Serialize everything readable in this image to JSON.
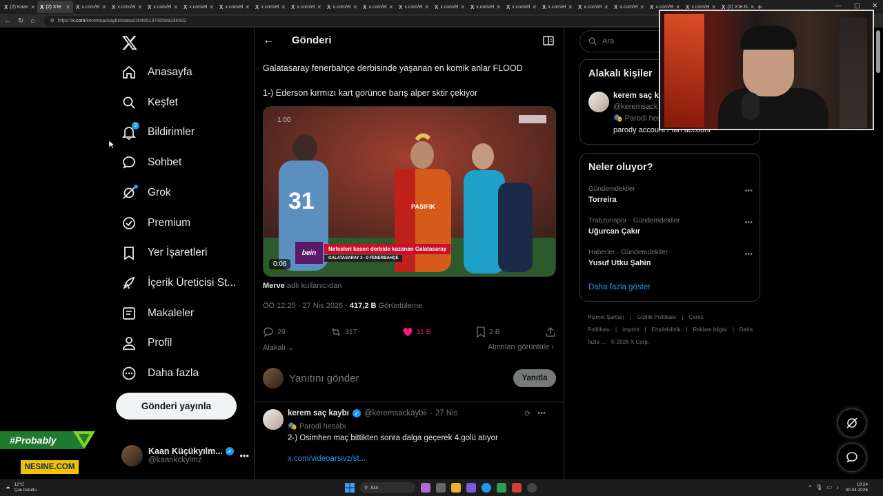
{
  "browser": {
    "tabs": [
      {
        "label": "(2) Kaan",
        "active": false
      },
      {
        "label": "(2) X'te",
        "active": true
      },
      {
        "label": "x.com/el",
        "active": false
      },
      {
        "label": "x.com/el",
        "active": false
      },
      {
        "label": "x.com/el",
        "active": false
      },
      {
        "label": "x.com/el",
        "active": false
      },
      {
        "label": "x.com/el",
        "active": false
      },
      {
        "label": "x.com/el",
        "active": false
      },
      {
        "label": "x.com/el",
        "active": false
      },
      {
        "label": "x.com/el",
        "active": false
      },
      {
        "label": "x.com/el",
        "active": false
      },
      {
        "label": "x.com/el",
        "active": false
      },
      {
        "label": "x.com/el",
        "active": false
      },
      {
        "label": "x.com/el",
        "active": false
      },
      {
        "label": "x.com/el",
        "active": false
      },
      {
        "label": "x.com/el",
        "active": false
      },
      {
        "label": "x.com/el",
        "active": false
      },
      {
        "label": "x.com/el",
        "active": false
      },
      {
        "label": "x.com/el",
        "active": false
      },
      {
        "label": "x.com/el",
        "active": false
      },
      {
        "label": "(2) X'te G",
        "active": false
      }
    ],
    "url_prefix": "https://",
    "url_host": "x.com",
    "url_path": "/keremsackaybii/status/2048513730569236502"
  },
  "nav": {
    "items": [
      {
        "label": "Anasayfa",
        "icon": "home-icon"
      },
      {
        "label": "Keşfet",
        "icon": "search-icon"
      },
      {
        "label": "Bildirimler",
        "icon": "bell-icon",
        "badge": "2"
      },
      {
        "label": "Sohbet",
        "icon": "chat-icon"
      },
      {
        "label": "Grok",
        "icon": "grok-icon"
      },
      {
        "label": "Premium",
        "icon": "premium-icon"
      },
      {
        "label": "Yer İşaretleri",
        "icon": "bookmark-icon"
      },
      {
        "label": "İçerik Üreticisi St...",
        "icon": "rocket-icon"
      },
      {
        "label": "Makaleler",
        "icon": "article-icon"
      },
      {
        "label": "Profil",
        "icon": "person-icon"
      },
      {
        "label": "Daha fazla",
        "icon": "more-icon"
      }
    ],
    "post_button": "Gönderi yayınla",
    "account": {
      "name": "Kaan Küçükyılm...",
      "handle": "@kaankckylmz"
    }
  },
  "overlays": {
    "probably": "#Probably",
    "nesine": "NESINE.COM"
  },
  "main": {
    "header_title": "Gönderi",
    "post_text_1": "Galatasaray fenerbahçe derbisinde yaşanan en komik anlar FLOOD",
    "post_text_2": "1-) Ederson kırmızı kart görünce barış alper sktir çekiyor",
    "video": {
      "speed": "1.00",
      "duration": "0:06",
      "lower_third_title": "Nefesleri kesen derbide kazanan Galatasaray",
      "lower_third_score": "GALATASARAY 3 - 0 FENERBAHÇE",
      "channel": "bein"
    },
    "source_user": "Merve",
    "source_suffix": " adlı kullanıcıdan",
    "time": "ÖÖ 12:25 · 27 Nis 2026 · ",
    "views": "417,2 B",
    "views_label": " Görüntüleme",
    "actions": {
      "replies": "29",
      "reposts": "317",
      "likes": "11 B",
      "bookmarks": "2 B"
    },
    "related_label": "Alakalı",
    "quotes_label": "Alıntıları görüntüle",
    "reply_placeholder": "Yanıtını gönder",
    "reply_button": "Yanıtla",
    "reply": {
      "name": "kerem saç kaybı",
      "handle": "@keremsackaybii",
      "date": "· 27 Nis",
      "parody": "Parodi hesabı",
      "text": "2-) Osimhen maç bittikten sonra dalga geçerek 4.golü atıyor",
      "link": "x.com/videoarsivz/st..."
    }
  },
  "right": {
    "search_placeholder": "Ara",
    "related_title": "Alakalı kişiler",
    "person": {
      "name": "kerem saç ka",
      "handle": "@keremsack",
      "parody": "Parodi hes",
      "bio": "parody account / fan account"
    },
    "trends_title": "Neler oluyor?",
    "trends": [
      {
        "context": "Gündemdekiler",
        "name": "Torreira"
      },
      {
        "context": "Trabzonspor · Gündemdekiler",
        "name": "Uğurcan Çakır"
      },
      {
        "context": "Haberler · Gündemdekiler",
        "name": "Yusuf Utku Şahin"
      }
    ],
    "show_more": "Daha fazla göster",
    "footer": [
      "Hizmet Şartları",
      "Gizlilik Politikası",
      "Çerez Politikası",
      "Imprint",
      "Erişilebilirlik",
      "Reklam bilgisi",
      "Daha fazla ...",
      "© 2026 X Corp."
    ]
  },
  "taskbar": {
    "temp": "12°C",
    "weather": "Çok bulutlu",
    "search": "Ara",
    "time": "18:24",
    "date": "30.04.2026"
  },
  "colors": {
    "accent": "#1d9bf0",
    "like": "#f91880",
    "bg": "#000000",
    "border": "#2f3336"
  }
}
